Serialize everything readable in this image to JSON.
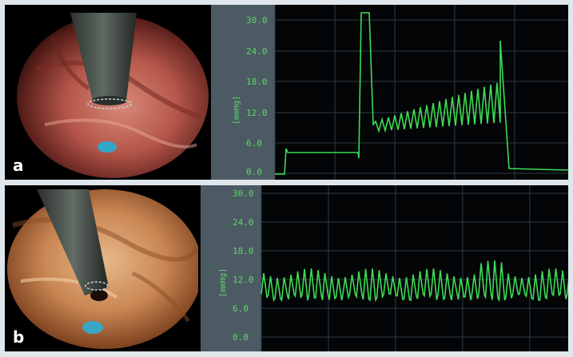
{
  "panels": [
    {
      "letter": "a",
      "unit": "[mmHg]",
      "y_ticks": [
        "30.0",
        "24.0",
        "18.0",
        "12.0",
        "6.0",
        "0.0"
      ]
    },
    {
      "letter": "b",
      "unit": "[mmHg]",
      "y_ticks": [
        "30.0",
        "24.0",
        "18.0",
        "12.0",
        "6.0",
        "0.0"
      ]
    }
  ],
  "colors": {
    "trace": "#3ddc54",
    "axis_text": "#5fd66a",
    "grid": "#2c3d46",
    "axis_bar": "#8c9aa3"
  }
}
